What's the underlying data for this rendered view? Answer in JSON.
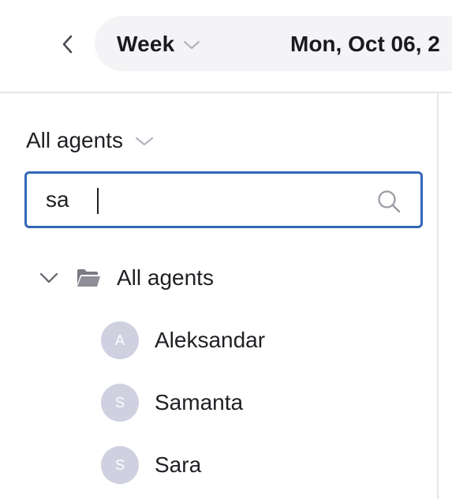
{
  "toolbar": {
    "back_icon": "chevron-left-icon",
    "view_label": "Week",
    "view_chevron_icon": "chevron-down-icon",
    "date_label": "Mon, Oct 06, 2"
  },
  "sidebar": {
    "agent_filter_label": "All agents",
    "agent_filter_icon": "chevron-down-icon",
    "search": {
      "value": "sa",
      "icon": "search-icon"
    },
    "tree": {
      "group_label": "All agents",
      "group_expanded": true,
      "agents": [
        {
          "initial": "A",
          "name": "Aleksandar"
        },
        {
          "initial": "S",
          "name": "Samanta"
        },
        {
          "initial": "S",
          "name": "Sara"
        }
      ]
    }
  },
  "colors": {
    "focus_border": "#3467b7",
    "avatar_bg": "#cfd0e0",
    "pill_bg": "#f4f4f6",
    "divider": "#e6e6e9"
  }
}
